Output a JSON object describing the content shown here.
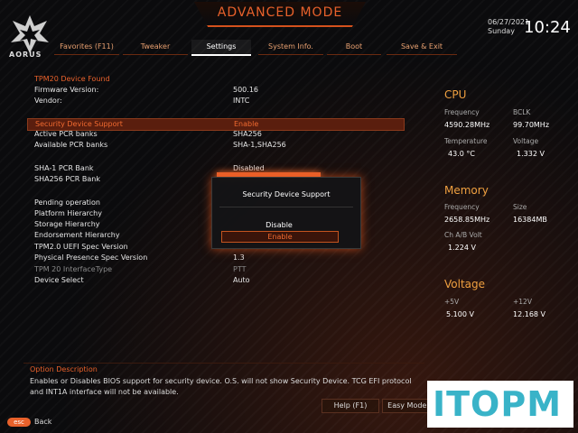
{
  "header": {
    "mode_title": "ADVANCED MODE",
    "logo_text": "AORUS",
    "date": "06/27/2021",
    "day": "Sunday",
    "time": "10:24"
  },
  "tabs": [
    {
      "label": "Favorites (F11)"
    },
    {
      "label": "Tweaker"
    },
    {
      "label": "Settings"
    },
    {
      "label": "System Info."
    },
    {
      "label": "Boot"
    },
    {
      "label": "Save & Exit"
    }
  ],
  "active_tab": "Settings",
  "settings": [
    {
      "label": "TPM20 Device Found",
      "value": ""
    },
    {
      "label": "Firmware Version:",
      "value": "500.16"
    },
    {
      "label": "Vendor:",
      "value": "INTC"
    },
    {
      "label": "Security Device Support",
      "value": "Enable"
    },
    {
      "label": "Active PCR banks",
      "value": "SHA256"
    },
    {
      "label": "Available PCR banks",
      "value": "SHA-1,SHA256"
    },
    {
      "label": "SHA-1 PCR Bank",
      "value": "Disabled"
    },
    {
      "label": "SHA256 PCR Bank",
      "value": ""
    },
    {
      "label": "Pending operation",
      "value": ""
    },
    {
      "label": "Platform Hierarchy",
      "value": ""
    },
    {
      "label": "Storage Hierarchy",
      "value": ""
    },
    {
      "label": "Endorsement Hierarchy",
      "value": ""
    },
    {
      "label": "TPM2.0 UEFI Spec Version",
      "value": ""
    },
    {
      "label": "Physical Presence Spec Version",
      "value": "1.3"
    },
    {
      "label": "TPM 20 InterfaceType",
      "value": "PTT"
    },
    {
      "label": "Device Select",
      "value": "Auto"
    }
  ],
  "dialog": {
    "title": "Security Device Support",
    "options": [
      "Disable",
      "Enable"
    ],
    "selected": "Enable"
  },
  "cpu": {
    "title": "CPU",
    "freq_label": "Frequency",
    "freq": "4590.28MHz",
    "bclk_label": "BCLK",
    "bclk": "99.70MHz",
    "temp_label": "Temperature",
    "temp": "43.0 °C",
    "volt_label": "Voltage",
    "volt": "1.332 V"
  },
  "memory": {
    "title": "Memory",
    "freq_label": "Frequency",
    "freq": "2658.85MHz",
    "size_label": "Size",
    "size": "16384MB",
    "chab_label": "Ch A/B Volt",
    "chab": "1.224 V"
  },
  "voltage": {
    "title": "Voltage",
    "v5_label": "+5V",
    "v5": "5.100 V",
    "v12_label": "+12V",
    "v12": "12.168 V"
  },
  "option_description": {
    "title": "Option Description",
    "text": "Enables or Disables BIOS support for security device. O.S. will not show Security Device. TCG EFI protocol and INT1A interface will not be available."
  },
  "bottom": {
    "help": "Help (F1)",
    "easy_mode": "Easy Mode (F2)",
    "esc": "esc",
    "back": "Back"
  },
  "watermark": "ITOPM",
  "colors": {
    "accent": "#e8612b",
    "highlight_bg": "#5a1e0e",
    "panel_heading": "#f0a040",
    "watermark": "#39b3c8"
  }
}
